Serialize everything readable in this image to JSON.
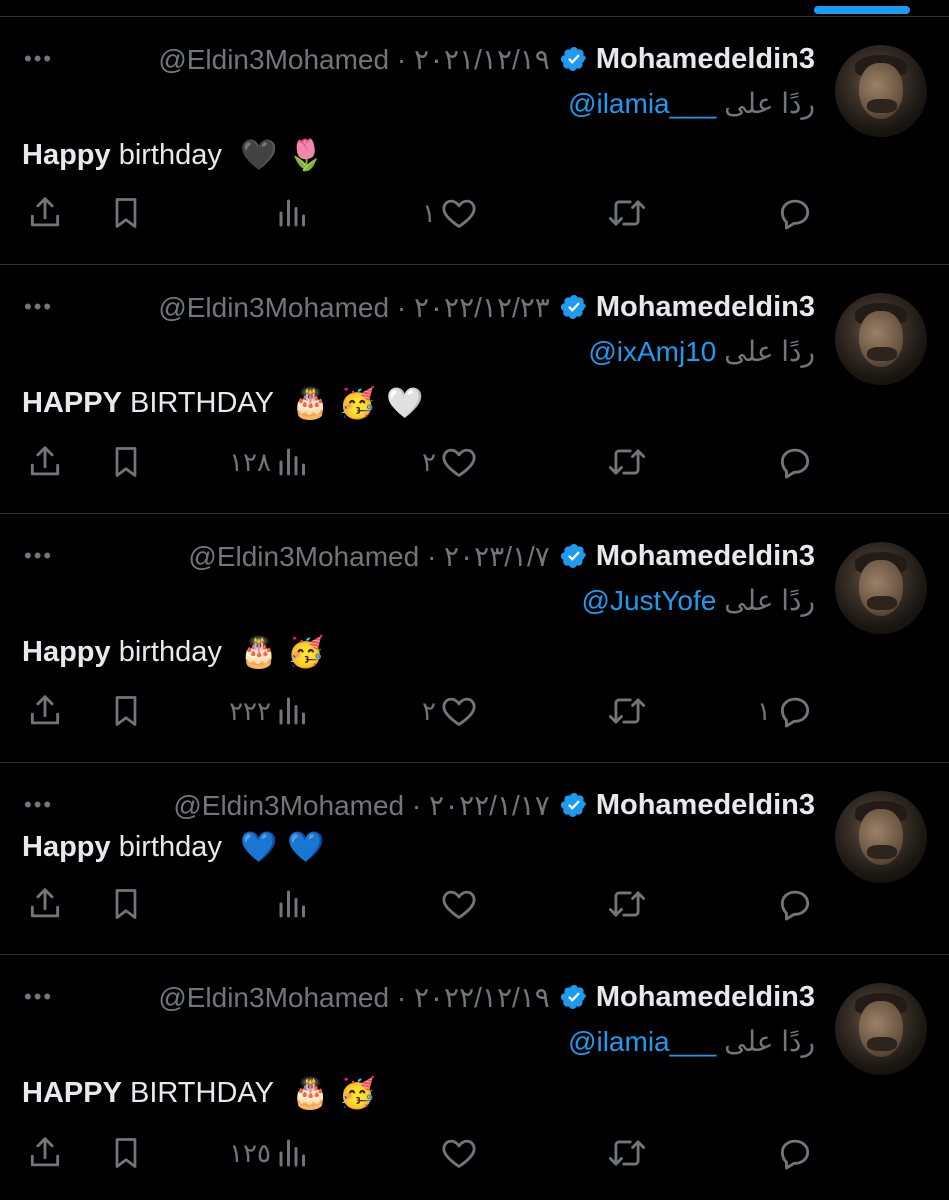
{
  "colors": {
    "background": "#000000",
    "text": "#e7e9ea",
    "muted": "#71767b",
    "accent": "#1d9bf0",
    "divider": "#2f3336"
  },
  "tweets": [
    {
      "name": "Mohamedeldin3",
      "handle_date": "@Eldin3Mohamed · ٢٠٢١/١٢/١٩",
      "reply_prefix": "ردًا على",
      "reply_handle": "@ilamia___",
      "text_bold": "Happy",
      "text_rest": " birthday",
      "emojis": [
        "🖤",
        "🌷"
      ],
      "views": "",
      "likes": "١",
      "retweets": "",
      "replies": ""
    },
    {
      "name": "Mohamedeldin3",
      "handle_date": "@Eldin3Mohamed · ٢٠٢٢/١٢/٢٣",
      "reply_prefix": "ردًا على",
      "reply_handle": "@ixAmj10",
      "text_bold": "HAPPY",
      "text_rest": " BIRTHDAY",
      "emojis": [
        "🎂",
        "🥳",
        "🤍"
      ],
      "views": "١٢٨",
      "likes": "٢",
      "retweets": "",
      "replies": ""
    },
    {
      "name": "Mohamedeldin3",
      "handle_date": "@Eldin3Mohamed · ٢٠٢٣/١/٧",
      "reply_prefix": "ردًا على",
      "reply_handle": "@JustYofe",
      "text_bold": "Happy",
      "text_rest": " birthday",
      "emojis": [
        "🎂",
        "🥳"
      ],
      "views": "٢٢٢",
      "likes": "٢",
      "retweets": "",
      "replies": "١"
    },
    {
      "name": "Mohamedeldin3",
      "handle_date": "@Eldin3Mohamed · ٢٠٢٢/١/١٧",
      "reply_prefix": "",
      "reply_handle": "",
      "text_bold": "Happy",
      "text_rest": " birthday",
      "emojis": [
        "💙",
        "💙"
      ],
      "views": "",
      "likes": "",
      "retweets": "",
      "replies": ""
    },
    {
      "name": "Mohamedeldin3",
      "handle_date": "@Eldin3Mohamed · ٢٠٢٢/١٢/١٩",
      "reply_prefix": "ردًا على",
      "reply_handle": "@ilamia___",
      "text_bold": "HAPPY",
      "text_rest": " BIRTHDAY",
      "emojis": [
        "🎂",
        "🥳"
      ],
      "views": "١٢٥",
      "likes": "",
      "retweets": "",
      "replies": ""
    }
  ],
  "icons": {
    "more": "more-icon",
    "verified": "verified-badge-icon",
    "share": "share-icon",
    "bookmark": "bookmark-icon",
    "views": "views-icon",
    "like": "heart-icon",
    "retweet": "retweet-icon",
    "reply": "reply-icon"
  }
}
